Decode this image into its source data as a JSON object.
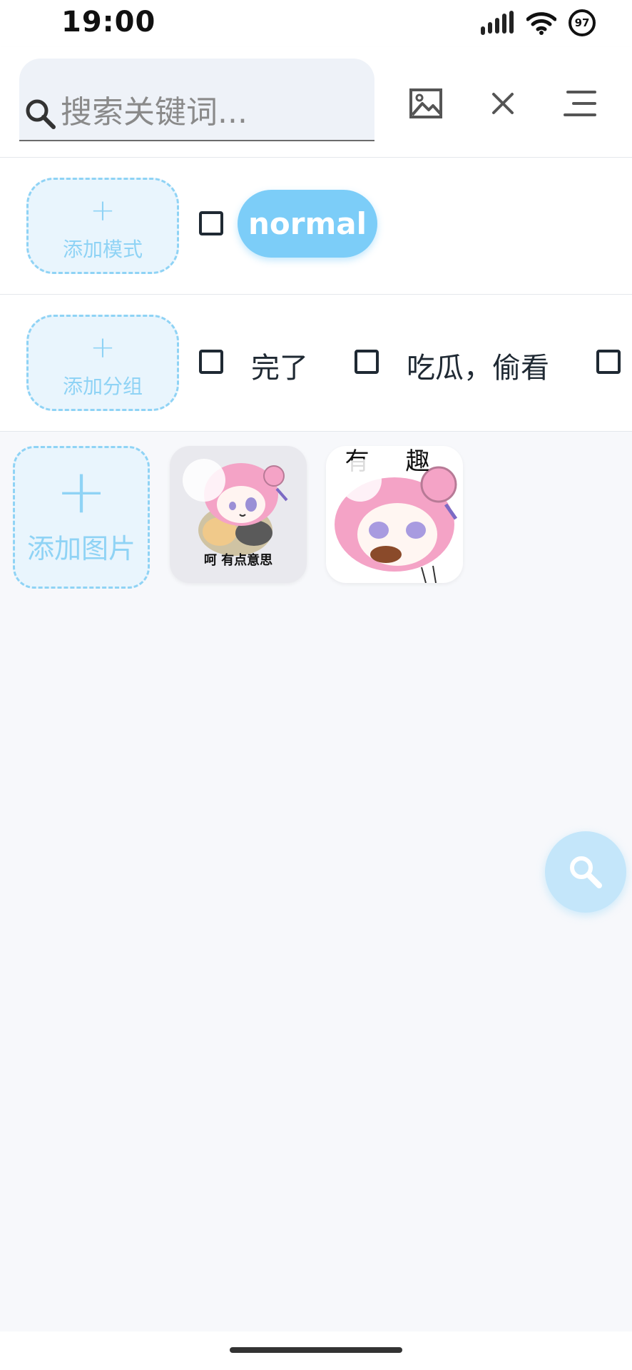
{
  "status_bar": {
    "time": "19:00",
    "battery_level": "97",
    "icons": [
      "signal-icon",
      "wifi-icon",
      "battery-ring-icon"
    ]
  },
  "top_bar": {
    "search": {
      "placeholder": "搜索关键词...",
      "value": ""
    },
    "buttons": [
      "image-icon",
      "close-icon",
      "menu-icon"
    ]
  },
  "modes": {
    "add_label": "添加模式",
    "items": [
      {
        "label": "normal",
        "selected": true
      }
    ]
  },
  "groups": {
    "add_label": "添加分组",
    "items": [
      {
        "label": "完了",
        "checked": false
      },
      {
        "label": "吃瓜，偷看",
        "checked": false
      }
    ]
  },
  "images": {
    "add_label": "添加图片",
    "items": [
      {
        "caption": "呵 有点意思"
      },
      {
        "caption": "有 趣"
      }
    ]
  },
  "colors": {
    "accent": "#7ccdf8",
    "accent_light": "#e9f5fd",
    "dashed_border": "#8fd3f5",
    "text": "#1f2933",
    "background": "#f7f8fb"
  },
  "fab": {
    "icon": "search-icon"
  }
}
